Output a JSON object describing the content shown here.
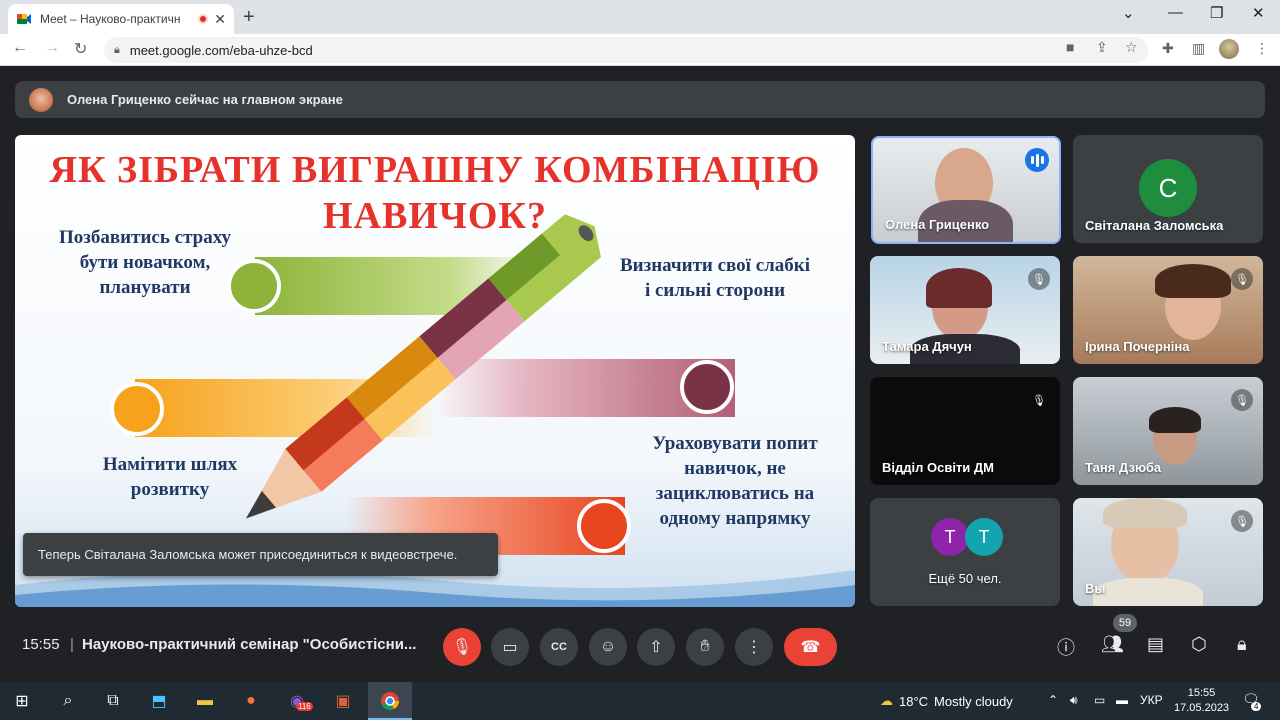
{
  "browser": {
    "tab_title": "Meet – Науково-практичн",
    "url": "meet.google.com/eba-uhze-bcd"
  },
  "banner": {
    "text": "Олена Гриценко сейчас на главном экране"
  },
  "slide": {
    "title_line1": "ЯК ЗІБРАТИ ВИГРАШНУ КОМБІНАЦІЮ",
    "title_line2": "НАВИЧОК?",
    "text_tl_1": "Позбавитись страху",
    "text_tl_2": "бути новачком,",
    "text_tl_3": "планувати",
    "text_tr_1": "Визначити свої слабкі",
    "text_tr_2": "і сильні сторони",
    "text_ml_1": "Намітити шлях",
    "text_ml_2": "розвитку",
    "text_mr_1": "Ураховувати попит",
    "text_mr_2": "навичок, не",
    "text_mr_3": "зациклюватись на",
    "text_mr_4": "одному напрямку",
    "colors": {
      "title": "#e5322b",
      "text": "#1f3864",
      "green": "#8db33a",
      "pink": "#9b4a5e",
      "orange": "#f7a21b",
      "red": "#e8451f"
    }
  },
  "toast": {
    "text": "Теперь Світалана Заломська может присоединиться к видеовстрече."
  },
  "tiles": {
    "t1": {
      "name": "Олена Гриценко"
    },
    "t2": {
      "name": "Світалана Заломська",
      "initial": "С"
    },
    "t3": {
      "name": "Тамара Дячун"
    },
    "t4": {
      "name": "Ірина Почерніна"
    },
    "t5": {
      "name": "Відділ Освіти ДМ"
    },
    "t6": {
      "name": "Таня Дзюба"
    },
    "t7": {
      "more": "Ещё 50 чел.",
      "a1": "Т",
      "a2": "Т"
    },
    "t8": {
      "name": "Вы"
    }
  },
  "controls": {
    "time": "15:55",
    "separator": "|",
    "meeting_title": "Науково-практичний семінар \"Особистісни...",
    "people_count": "59"
  },
  "taskbar": {
    "weather_temp": "18°C",
    "weather_desc": "Mostly cloudy",
    "lang": "УКР",
    "time": "15:55",
    "date": "17.05.2023",
    "viber_badge": "116",
    "notif_count": "4"
  }
}
